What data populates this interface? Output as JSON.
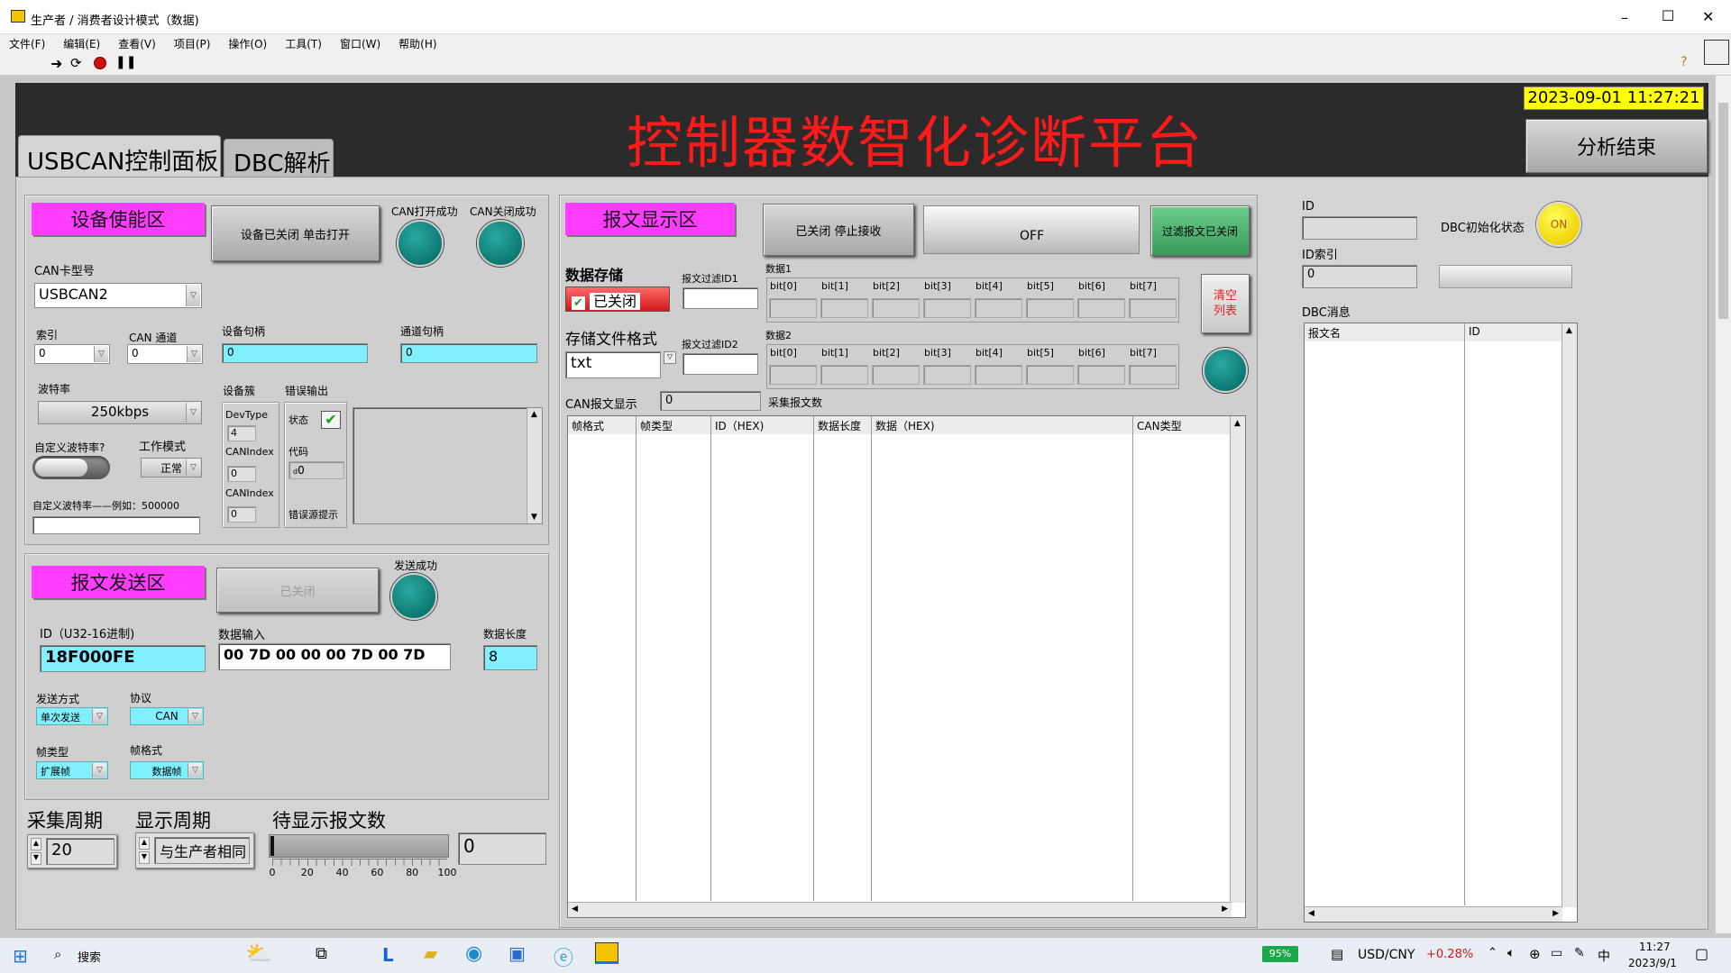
{
  "window": {
    "title": "生产者 / 消费者设计模式（数据)",
    "min": "–",
    "max": "☐",
    "close": "✕"
  },
  "menu": [
    "文件(F)",
    "编辑(E)",
    "查看(V)",
    "项目(P)",
    "操作(O)",
    "工具(T)",
    "窗口(W)",
    "帮助(H)"
  ],
  "header": {
    "title": "控制器数智化诊断平台",
    "datetime": "2023-09-01 11:27:21",
    "end_button": "分析结束"
  },
  "tabs": [
    "USBCAN控制面板",
    "DBC解析"
  ],
  "device": {
    "section": "设备使能区",
    "toggle_button": "设备已关闭 单击打开",
    "open_ok": "CAN打开成功",
    "close_ok": "CAN关闭成功",
    "card_type_label": "CAN卡型号",
    "card_type": "USBCAN2",
    "index_label": "索引",
    "index": "0",
    "channel_label": "CAN 通道",
    "channel": "0",
    "dev_handle_label": "设备句柄",
    "dev_handle": "0",
    "ch_handle_label": "通道句柄",
    "ch_handle": "0",
    "baud_label": "波特率",
    "baud": "250kbps",
    "custom_label": "自定义波特率?",
    "work_mode_label": "工作模式",
    "work_mode": "正常",
    "custom_hint": "自定义波特率——例如：500000",
    "custom_value": "",
    "cluster_label": "设备簇",
    "devtype_label": "DevType",
    "devtype": "4",
    "canindex_label": "CANIndex",
    "canindex": "0",
    "canindex2_label": "CANIndex",
    "canindex2": "0",
    "err_label": "错误输出",
    "status_label": "状态",
    "code_label": "代码",
    "code": "0",
    "err_src_label": "错误源提示"
  },
  "send": {
    "section": "报文发送区",
    "button": "已关闭",
    "send_ok": "发送成功",
    "id_label": "ID（U32-16进制)",
    "id": "18F000FE",
    "data_label": "数据输入",
    "data": "00 7D 00 00 00 7D 00 7D",
    "len_label": "数据长度",
    "len": "8",
    "mode_label": "发送方式",
    "mode": "单次发送",
    "proto_label": "协议",
    "proto": "CAN",
    "frame_type_label": "帧类型",
    "frame_type": "扩展帧",
    "frame_fmt_label": "帧格式",
    "frame_fmt": "数据帧"
  },
  "bottom": {
    "sample_label": "采集周期",
    "sample": "20",
    "display_label": "显示周期",
    "display": "与生产者相同",
    "pending_label": "待显示报文数",
    "pending": "0",
    "ticks": [
      "0",
      "20",
      "40",
      "60",
      "80",
      "100"
    ],
    "slider_level": 0
  },
  "msg": {
    "section": "报文显示区",
    "stop_button": "已关闭 停止接收",
    "off_label": "OFF",
    "filter_button": "过滤报文已关闭",
    "storage_label": "数据存储",
    "storage_state": "已关闭",
    "filter1_label": "报文过滤ID1",
    "filter2_label": "报文过滤ID2",
    "format_label": "存储文件格式",
    "format": "txt",
    "data1_label": "数据1",
    "data2_label": "数据2",
    "bits": [
      "bit[0]",
      "bit[1]",
      "bit[2]",
      "bit[3]",
      "bit[4]",
      "bit[5]",
      "bit[6]",
      "bit[7]"
    ],
    "clear_button": "清空\n列表",
    "can_display_label": "CAN报文显示",
    "can_display": "0",
    "collect_label": "采集报文数",
    "columns": [
      "帧格式",
      "帧类型",
      "ID（HEX)",
      "数据长度",
      "数据（HEX)",
      "CAN类型"
    ]
  },
  "dbc": {
    "id_label": "ID",
    "id": "",
    "init_label": "DBC初始化状态",
    "init_state": "ON",
    "index_label": "ID索引",
    "index": "0",
    "msg_label": "DBC消息",
    "columns": [
      "报文名",
      "ID"
    ]
  },
  "taskbar": {
    "search": "搜索",
    "battery": "95%",
    "currency": "USD/CNY",
    "change": "+0.28%",
    "ime": "中",
    "time": "11:27",
    "date": "2023/9/1"
  },
  "colors": {
    "header_bg": "#2b2b2b",
    "title_red": "#ff1a1a",
    "pink": "#ff3cff",
    "cyan": "#80f0ff",
    "led": "#0a7670",
    "yellow": "#ffff00"
  }
}
